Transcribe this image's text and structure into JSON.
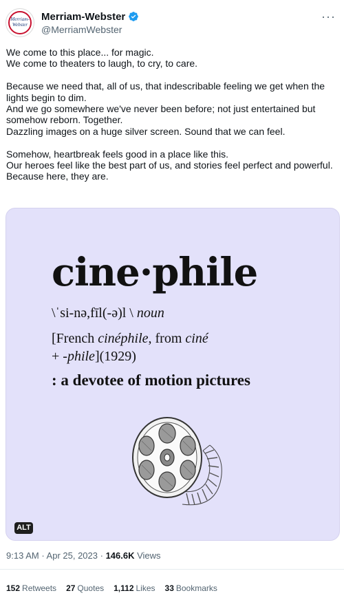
{
  "account": {
    "display_name": "Merriam-Webster",
    "handle": "@MerriamWebster",
    "avatar_text": "Merriam-Webster",
    "more_label": "···"
  },
  "tweet": {
    "paragraphs": [
      [
        "We come to this place... for magic.",
        "We come to theaters to laugh, to cry, to care."
      ],
      [
        "Because we need that, all of us, that indescribable feeling we get when the lights begin to dim.",
        "And we go somewhere we've never been before; not just entertained but somehow reborn. Together.",
        "Dazzling images on a huge silver screen. Sound that we can feel."
      ],
      [
        "Somehow, heartbreak feels good in a place like this.",
        "Our heroes feel like the best part of us, and stories feel perfect and powerful.",
        "Because here, they are."
      ]
    ]
  },
  "media": {
    "word": "cine·phile",
    "pronunciation": "\\ˈsi-nə,fīl(-ə)l \\",
    "part_of_speech": "noun",
    "etymology": {
      "prefix": "[French ",
      "french_word": "cinéphile",
      "middle": ", from ",
      "cine": "ciné",
      "plus": "+ ",
      "phile": "-phile",
      "suffix": "](1929)"
    },
    "definition": ": a devotee of motion pictures",
    "illustration_icon": "film-reel-icon",
    "alt_badge": "ALT",
    "background_color": "#e3e1fa"
  },
  "meta": {
    "time": "9:13 AM",
    "separator": " · ",
    "date": "Apr 25, 2023",
    "views_count": "146.6K",
    "views_label": " Views"
  },
  "stats": {
    "retweets_count": "152",
    "retweets_label": "Retweets",
    "quotes_count": "27",
    "quotes_label": "Quotes",
    "likes_count": "1,112",
    "likes_label": "Likes",
    "bookmarks_count": "33",
    "bookmarks_label": "Bookmarks"
  },
  "colors": {
    "verified_blue": "#1d9bf0",
    "brand_red": "#c8102e",
    "brand_navy": "#1d3c7a",
    "muted_text": "#536471"
  }
}
